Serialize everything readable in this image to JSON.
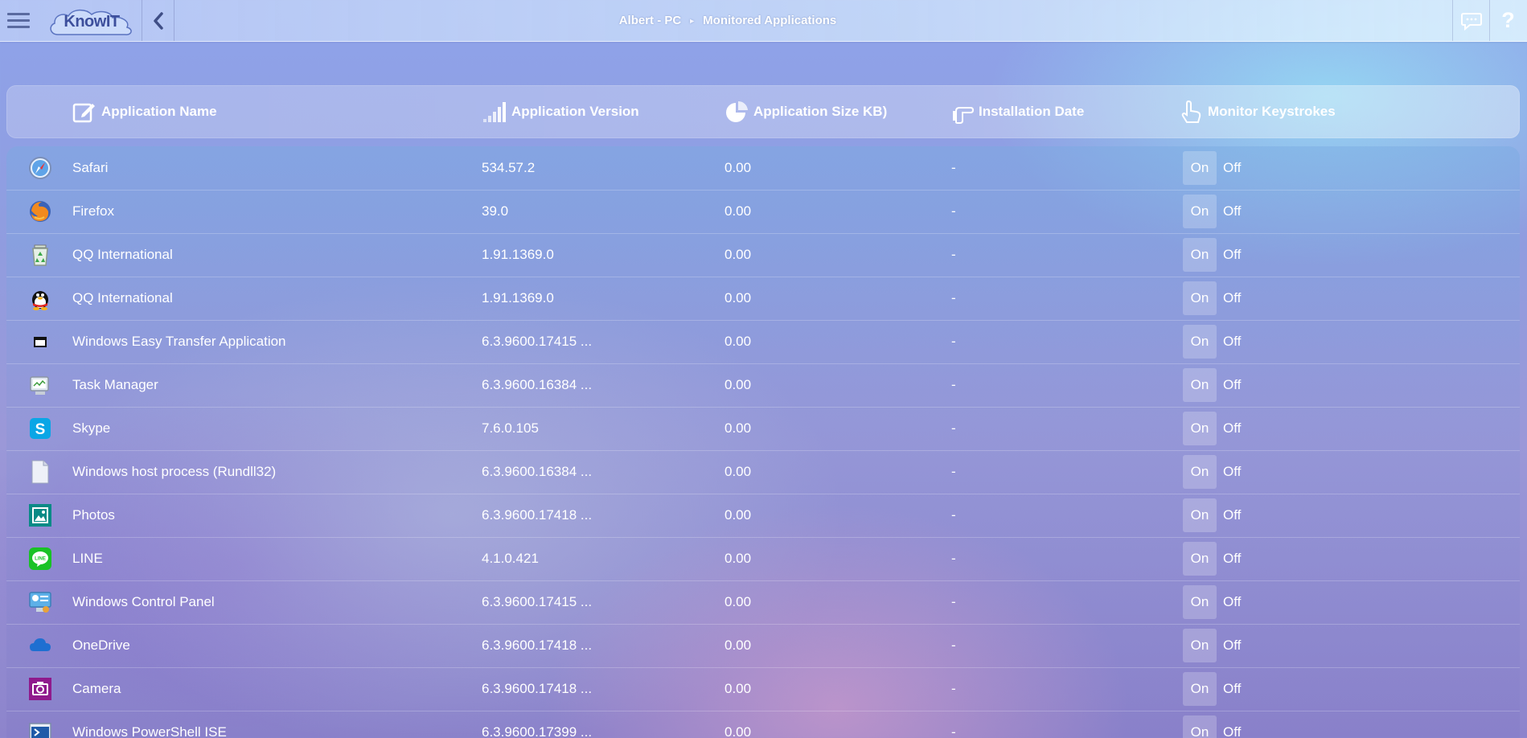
{
  "app": {
    "logo_text": "KnowIT",
    "breadcrumb": {
      "parent": "Albert - PC",
      "current": "Monitored Applications"
    },
    "help_label": "?"
  },
  "table": {
    "columns": {
      "name": "Application Name",
      "version": "Application Version",
      "size": "Application Size KB)",
      "date": "Installation Date",
      "keystrokes": "Monitor Keystrokes"
    },
    "toggle_on": "On",
    "toggle_off": "Off",
    "rows": [
      {
        "name": "Safari",
        "version": "534.57.2",
        "size": "0.00",
        "date": "-",
        "icon": "safari-icon"
      },
      {
        "name": "Firefox",
        "version": "39.0",
        "size": "0.00",
        "date": "-",
        "icon": "firefox-icon"
      },
      {
        "name": "QQ International",
        "version": "1.91.1369.0",
        "size": "0.00",
        "date": "-",
        "icon": "recycle-bin-icon"
      },
      {
        "name": "QQ International",
        "version": "1.91.1369.0",
        "size": "0.00",
        "date": "-",
        "icon": "qq-penguin-icon"
      },
      {
        "name": "Windows Easy Transfer Application",
        "version": "6.3.9600.17415 ...",
        "size": "0.00",
        "date": "-",
        "icon": "window-icon"
      },
      {
        "name": "Task Manager",
        "version": "6.3.9600.16384 ...",
        "size": "0.00",
        "date": "-",
        "icon": "task-manager-icon"
      },
      {
        "name": "Skype",
        "version": "7.6.0.105",
        "size": "0.00",
        "date": "-",
        "icon": "skype-icon"
      },
      {
        "name": "Windows host process (Rundll32)",
        "version": "6.3.9600.16384 ...",
        "size": "0.00",
        "date": "-",
        "icon": "document-icon"
      },
      {
        "name": "Photos",
        "version": "6.3.9600.17418 ...",
        "size": "0.00",
        "date": "-",
        "icon": "photos-icon"
      },
      {
        "name": "LINE",
        "version": "4.1.0.421",
        "size": "0.00",
        "date": "-",
        "icon": "line-icon"
      },
      {
        "name": "Windows Control Panel",
        "version": "6.3.9600.17415 ...",
        "size": "0.00",
        "date": "-",
        "icon": "control-panel-icon"
      },
      {
        "name": "OneDrive",
        "version": "6.3.9600.17418 ...",
        "size": "0.00",
        "date": "-",
        "icon": "onedrive-icon"
      },
      {
        "name": "Camera",
        "version": "6.3.9600.17418 ...",
        "size": "0.00",
        "date": "-",
        "icon": "camera-icon"
      },
      {
        "name": "Windows PowerShell ISE",
        "version": "6.3.9600.17399 ...",
        "size": "0.00",
        "date": "-",
        "icon": "powershell-icon"
      }
    ]
  }
}
